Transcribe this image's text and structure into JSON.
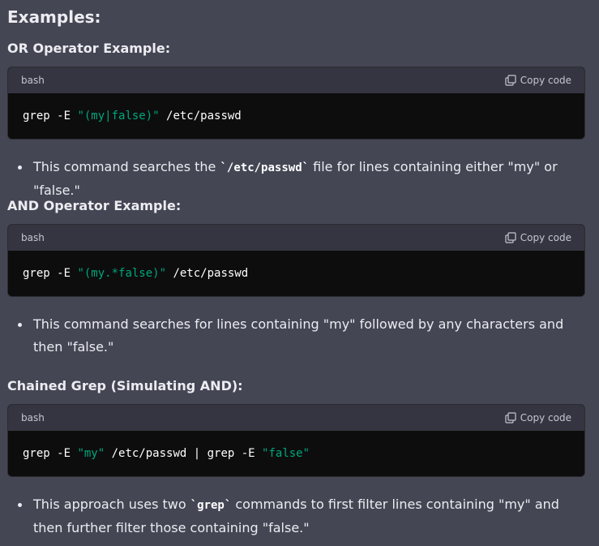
{
  "heading": "Examples:",
  "sections": [
    {
      "title": "OR Operator Example:",
      "code": {
        "language": "bash",
        "copy_label": "Copy code",
        "pre": "grep -E ",
        "str1": "\"(my|false)\"",
        "post": " /etc/passwd"
      },
      "bullet": {
        "before": "This command searches the ",
        "code": "`/etc/passwd`",
        "after": " file for lines containing either \"my\" or \"false.\""
      }
    },
    {
      "title": "AND Operator Example:",
      "code": {
        "language": "bash",
        "copy_label": "Copy code",
        "pre": "grep -E ",
        "str1": "\"(my.*false)\"",
        "post": " /etc/passwd"
      },
      "bullet": {
        "text": "This command searches for lines containing \"my\" followed by any characters and then \"false.\""
      }
    },
    {
      "title": "Chained Grep (Simulating AND):",
      "code": {
        "language": "bash",
        "copy_label": "Copy code",
        "pre": "grep -E ",
        "str1": "\"my\"",
        "mid": " /etc/passwd | grep -E ",
        "str2": "\"false\""
      },
      "bullet": {
        "before": "This approach uses two ",
        "code": "`grep`",
        "after": " commands to first filter lines containing \"my\" and then further filter those containing \"false.\""
      }
    }
  ],
  "colors": {
    "background": "#444654",
    "code_header": "#343541",
    "code_body": "#0d0d0d",
    "string_token": "#00a67d"
  },
  "icons": {
    "copy": "clipboard-icon"
  }
}
